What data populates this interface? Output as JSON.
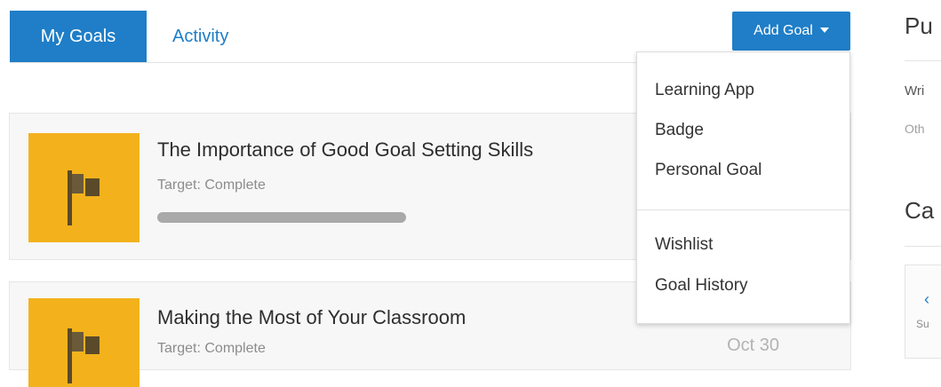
{
  "tabs": [
    {
      "label": "My Goals",
      "active": true
    },
    {
      "label": "Activity",
      "active": false
    }
  ],
  "add_goal": {
    "label": "Add Goal"
  },
  "dropdown": {
    "items": [
      "Learning App",
      "Badge",
      "Personal Goal",
      "Wishlist",
      "Goal History"
    ]
  },
  "goals": [
    {
      "title": "The Importance of Good Goal Setting Skills",
      "target": "Target: Complete",
      "progress_percent": 0
    },
    {
      "title": "Making the Most of Your Classroom",
      "target": "Target: Complete",
      "date": "Oct 30"
    }
  ],
  "right_panel": {
    "title1": "Pu",
    "text1": "Wri",
    "text2": "Oth",
    "title2": "Ca",
    "chevron_icon": "chevron-left-icon",
    "small_text": "Su"
  },
  "colors": {
    "accent": "#1f7ec7",
    "thumbnail": "#f3b21c",
    "card_bg": "#f7f7f7"
  }
}
